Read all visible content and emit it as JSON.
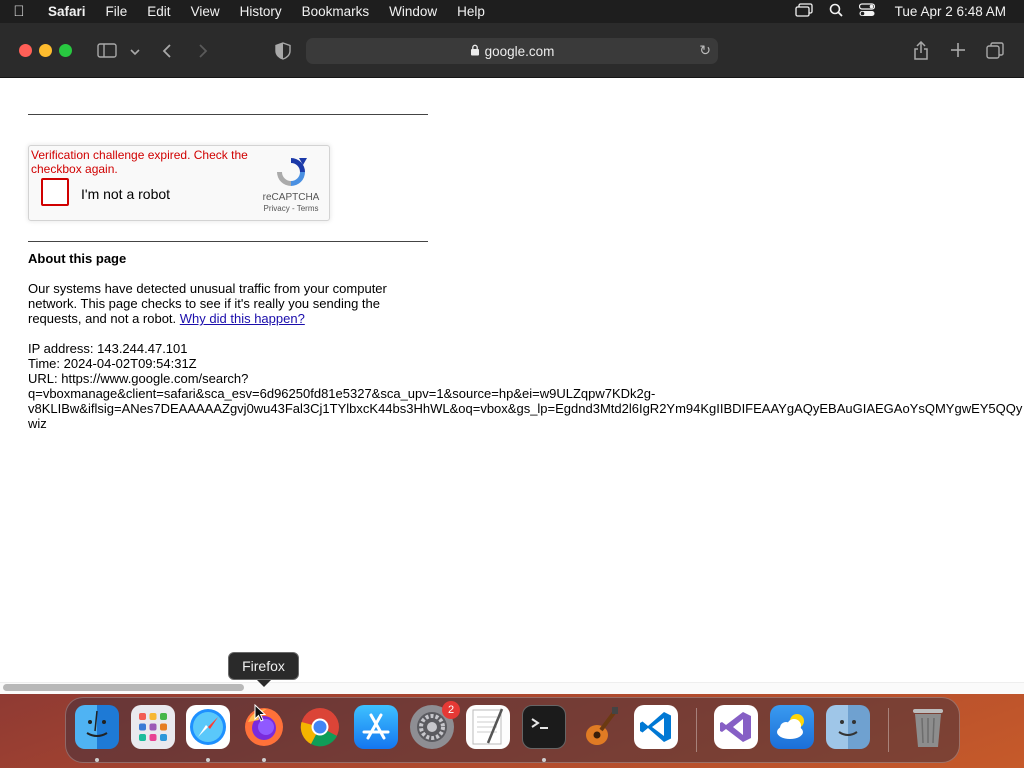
{
  "menubar": {
    "apple_icon": "apple-logo-icon",
    "app_name": "Safari",
    "items": [
      "File",
      "Edit",
      "View",
      "History",
      "Bookmarks",
      "Window",
      "Help"
    ],
    "clock": "Tue Apr 2  6:48 AM"
  },
  "toolbar": {
    "address": "google.com"
  },
  "captcha": {
    "error": "Verification challenge expired. Check the checkbox again.",
    "label": "I'm not a robot",
    "brand": "reCAPTCHA",
    "links": "Privacy - Terms",
    "error_color": "#d00000"
  },
  "content": {
    "about_title": "About this page",
    "paragraph": "Our systems have detected unusual traffic from your computer network. This page checks to see if it's really you sending the requests, and not a robot.",
    "why_link": "Why did this happen?",
    "ip_line": "IP address: 143.244.47.101",
    "time_line": "Time: 2024-04-02T09:54:31Z",
    "url_line1": "URL: https://www.google.com/search?",
    "url_line2": "q=vboxmanage&client=safari&sca_esv=6d96250fd81e5327&sca_upv=1&source=hp&ei=w9ULZqpw7KDk2g-",
    "url_line3": "v8KLIBw&iflsig=ANes7DEAAAAAZgvj0wu43Fal3Cj1TYlbxcK44bs3HhWL&oq=vbox&gs_lp=Egdnd3Mtd2l6IgR2Ym94KgIIBDIFEAAYgAQyEBAuGIAEGAoYsQMYgwEY5QQy",
    "url_line4": "wiz"
  },
  "tooltip": "Firefox",
  "dock": {
    "apps": [
      {
        "name": "Finder",
        "icon": "finder-icon",
        "running": true
      },
      {
        "name": "Launchpad",
        "icon": "launchpad-icon",
        "running": false
      },
      {
        "name": "Safari",
        "icon": "safari-icon",
        "running": true
      },
      {
        "name": "Firefox",
        "icon": "firefox-icon",
        "running": true
      },
      {
        "name": "Google Chrome",
        "icon": "chrome-icon",
        "running": false
      },
      {
        "name": "App Store",
        "icon": "app-store-icon",
        "running": false
      },
      {
        "name": "System Settings",
        "icon": "settings-icon",
        "running": false,
        "badge": "2"
      },
      {
        "name": "TextEdit",
        "icon": "textedit-icon",
        "running": false
      },
      {
        "name": "Terminal",
        "icon": "terminal-icon",
        "running": true
      },
      {
        "name": "GarageBand",
        "icon": "garageband-icon",
        "running": false
      },
      {
        "name": "Visual Studio Code",
        "icon": "vscode-icon",
        "running": false
      },
      {
        "name": "Visual Studio",
        "icon": "visual-studio-icon",
        "running": false
      },
      {
        "name": "Weather",
        "icon": "weather-icon",
        "running": false
      },
      {
        "name": "Finder (Downloads)",
        "icon": "finder-folder-icon",
        "running": false
      },
      {
        "name": "Trash",
        "icon": "trash-icon",
        "running": false
      }
    ]
  }
}
